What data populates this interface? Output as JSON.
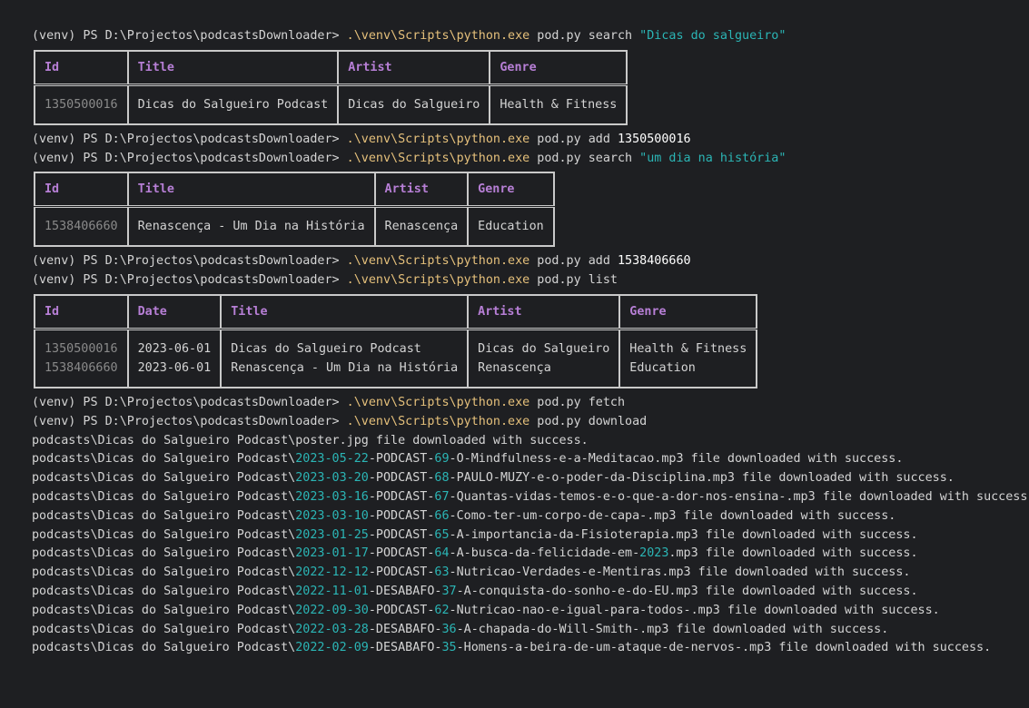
{
  "prompt": "(venv) PS D:\\Projectos\\podcastsDownloader> ",
  "python_cmd": ".\\venv\\Scripts\\python.exe",
  "cmd1": {
    "args": " pod.py search ",
    "query": "\"Dicas do salgueiro\""
  },
  "table1": {
    "headers": [
      "Id",
      "Title",
      "Artist",
      "Genre"
    ],
    "rows": [
      [
        "1350500016",
        "Dicas do Salgueiro Podcast",
        "Dicas do Salgueiro",
        "Health & Fitness"
      ]
    ]
  },
  "cmd2": {
    "args": " pod.py add ",
    "id": "1350500016"
  },
  "cmd3": {
    "args": " pod.py search ",
    "query": "\"um dia na história\""
  },
  "table2": {
    "headers": [
      "Id",
      "Title",
      "Artist",
      "Genre"
    ],
    "rows": [
      [
        "1538406660",
        "Renascença - Um Dia na História",
        "Renascença",
        "Education"
      ]
    ]
  },
  "cmd4": {
    "args": " pod.py add ",
    "id": "1538406660"
  },
  "cmd5": {
    "args": " pod.py list"
  },
  "table3": {
    "headers": [
      "Id",
      "Date",
      "Title",
      "Artist",
      "Genre"
    ],
    "rows": [
      [
        "1350500016",
        "2023-06-01",
        "Dicas do Salgueiro Podcast",
        "Dicas do Salgueiro",
        "Health & Fitness"
      ],
      [
        "1538406660",
        "2023-06-01",
        "Renascença - Um Dia na História",
        "Renascença",
        "Education"
      ]
    ]
  },
  "cmd6": {
    "args": " pod.py fetch"
  },
  "cmd7": {
    "args": " pod.py download"
  },
  "download_prefix": "podcasts\\Dicas do Salgueiro Podcast\\",
  "poster_line": "podcasts\\Dicas do Salgueiro Podcast\\poster.jpg file downloaded with success.",
  "success_suffix": " file downloaded with success.",
  "downloads": [
    {
      "date": "2023-05-22",
      "kind": "-PODCAST-",
      "num": "69",
      "name": "-O-Mindfulness-e-a-Meditacao.mp3"
    },
    {
      "date": "2023-03-20",
      "kind": "-PODCAST-",
      "num": "68",
      "name": "-PAULO-MUZY-e-o-poder-da-Disciplina.mp3"
    },
    {
      "date": "2023-03-16",
      "kind": "-PODCAST-",
      "num": "67",
      "name": "-Quantas-vidas-temos-e-o-que-a-dor-nos-ensina-.mp3"
    },
    {
      "date": "2023-03-10",
      "kind": "-PODCAST-",
      "num": "66",
      "name": "-Como-ter-um-corpo-de-capa-.mp3"
    },
    {
      "date": "2023-01-25",
      "kind": "-PODCAST-",
      "num": "65",
      "name": "-A-importancia-da-Fisioterapia.mp3"
    },
    {
      "date": "2023-01-17",
      "kind": "-PODCAST-",
      "num": "64",
      "name": "-A-busca-da-felicidade-em-",
      "year": "2023",
      "name2": ".mp3"
    },
    {
      "date": "2022-12-12",
      "kind": "-PODCAST-",
      "num": "63",
      "name": "-Nutricao-Verdades-e-Mentiras.mp3"
    },
    {
      "date": "2022-11-01",
      "kind": "-DESABAFO-",
      "num": "37",
      "name": "-A-conquista-do-sonho-e-do-EU.mp3"
    },
    {
      "date": "2022-09-30",
      "kind": "-PODCAST-",
      "num": "62",
      "name": "-Nutricao-nao-e-igual-para-todos-.mp3"
    },
    {
      "date": "2022-03-28",
      "kind": "-DESABAFO-",
      "num": "36",
      "name": "-A-chapada-do-Will-Smith-.mp3"
    },
    {
      "date": "2022-02-09",
      "kind": "-DESABAFO-",
      "num": "35",
      "name": "-Homens-a-beira-de-um-ataque-de-nervos-.mp3"
    }
  ]
}
